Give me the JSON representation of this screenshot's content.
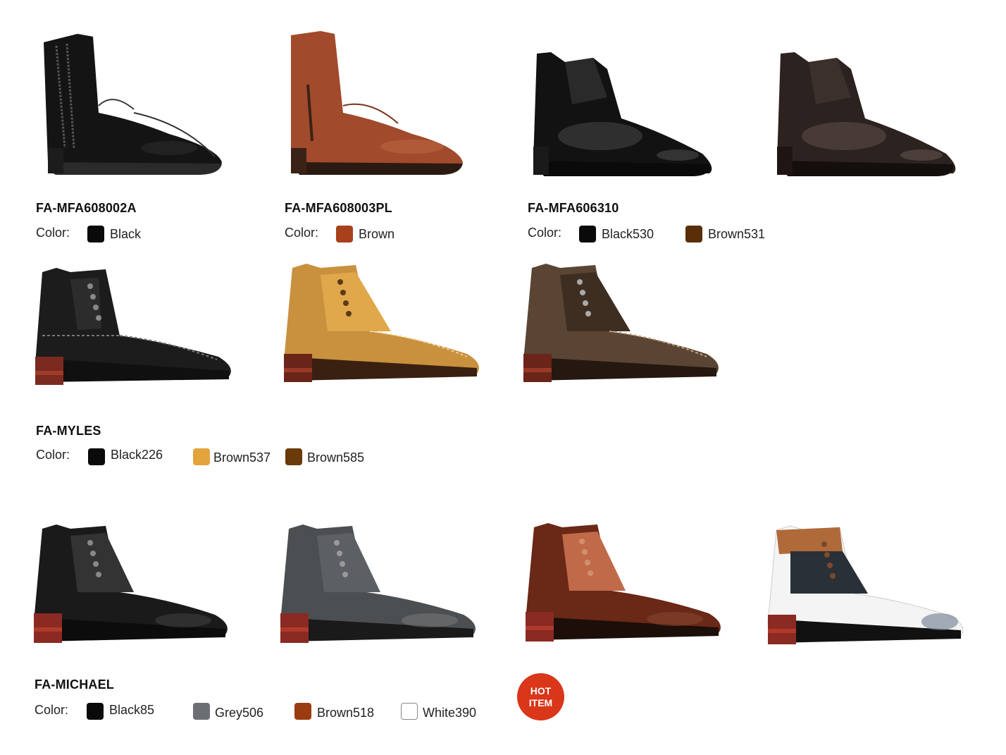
{
  "color_label": "Color:",
  "hot_badge": {
    "line1": "HOT",
    "line2": "ITEM",
    "color": "#d9361a"
  },
  "products": [
    {
      "model": "FA-MFA608002A",
      "colors": [
        {
          "name": "Black",
          "hex": "#0a0a0a"
        }
      ]
    },
    {
      "model": "FA-MFA608003PL",
      "colors": [
        {
          "name": "Brown",
          "hex": "#a8401c"
        }
      ]
    },
    {
      "model": "FA-MFA606310",
      "colors": [
        {
          "name": "Black530",
          "hex": "#0a0a0a"
        },
        {
          "name": "Brown531",
          "hex": "#5a2e08"
        }
      ]
    },
    {
      "model": "FA-MYLES",
      "colors": [
        {
          "name": "Black226",
          "hex": "#0a0a0a"
        },
        {
          "name": "Brown537",
          "hex": "#e3a43c"
        },
        {
          "name": "Brown585",
          "hex": "#6a3a0a"
        }
      ]
    },
    {
      "model": "FA-MICHAEL",
      "colors": [
        {
          "name": "Black85",
          "hex": "#0a0a0a"
        },
        {
          "name": "Grey506",
          "hex": "#6b6e73"
        },
        {
          "name": "Brown518",
          "hex": "#9a3c10"
        },
        {
          "name": "White390",
          "hex": "#ffffff"
        }
      ]
    }
  ],
  "shoe_images": [
    {
      "name": "black zip boot"
    },
    {
      "name": "brown zip boot"
    },
    {
      "name": "black patent wingtip boot"
    },
    {
      "name": "brown patent wingtip boot"
    },
    {
      "name": "black brogue boot"
    },
    {
      "name": "tan brogue boot"
    },
    {
      "name": "dark brown brogue boot"
    },
    {
      "name": "black michael boot"
    },
    {
      "name": "grey michael boot"
    },
    {
      "name": "brown michael boot"
    },
    {
      "name": "white michael boot"
    }
  ]
}
